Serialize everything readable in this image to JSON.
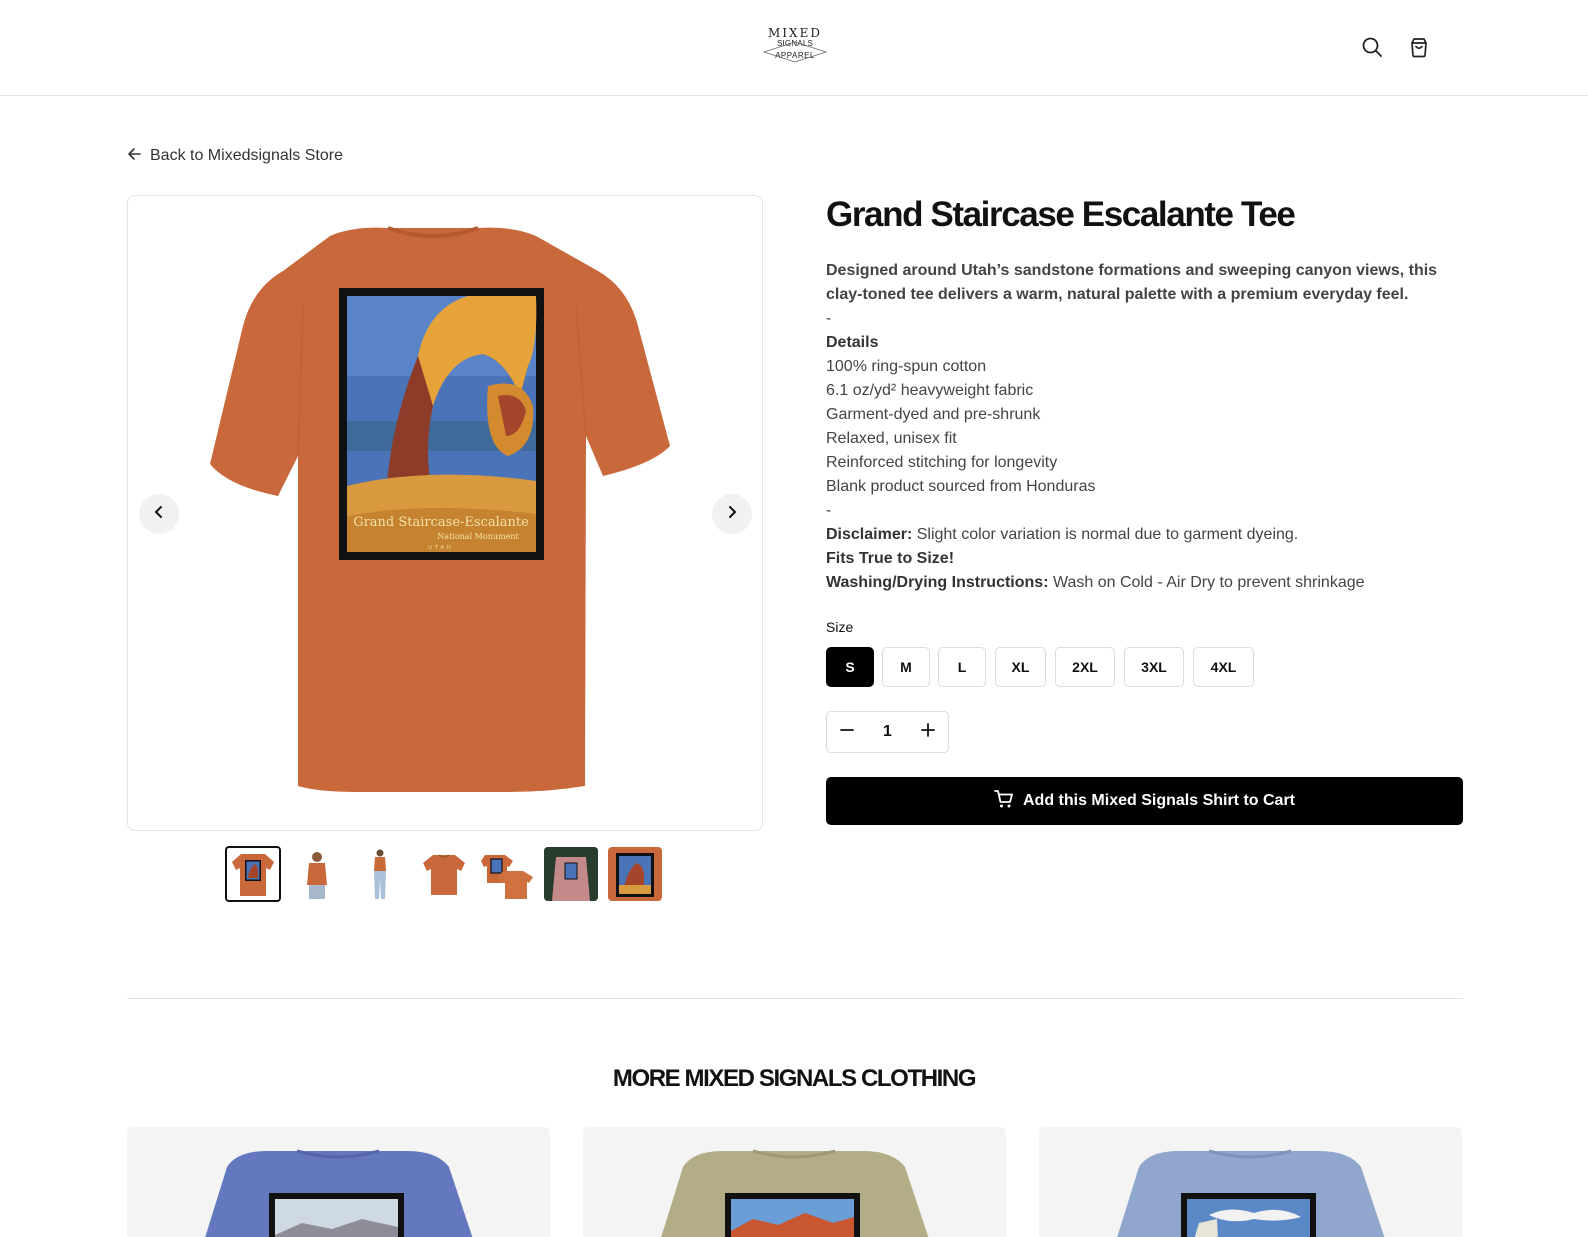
{
  "header": {
    "logo": {
      "line1": "MIXED",
      "line2": "SIGNALS",
      "line3": "APPAREL"
    },
    "search_icon": "search-icon",
    "cart_icon": "shopping-bag-icon"
  },
  "back_link": {
    "label": "Back to Mixedsignals Store",
    "icon": "arrow-left-icon"
  },
  "gallery": {
    "main_image_text": {
      "line1": "Grand Staircase-Escalante",
      "line2": "National Monument",
      "line3": "UTAH"
    },
    "prev_icon": "chevron-left-icon",
    "next_icon": "chevron-right-icon",
    "thumbnail_count": 7,
    "active_thumbnail": 1
  },
  "product": {
    "title": "Grand Staircase Escalante Tee",
    "intro_line1": "Designed around Utah’s sandstone formations and sweeping canyon views, this",
    "intro_line2": "clay-toned tee delivers a warm, natural palette with a premium everyday feel.",
    "separator": "-",
    "details_heading": "Details",
    "details": [
      "100% ring-spun cotton",
      "6.1 oz/yd² heavyweight fabric",
      "Garment-dyed and pre-shrunk",
      "Relaxed, unisex fit",
      "Reinforced stitching for longevity",
      "Blank product sourced from Honduras"
    ],
    "disclaimer_label": "Disclaimer:",
    "disclaimer_text": "Slight color variation is normal due to garment dyeing.",
    "fit_note": "Fits True to Size!",
    "washing_label": "Washing/Drying Instructions:",
    "washing_text": "Wash on Cold - Air Dry to prevent shrinkage",
    "size_label": "Size",
    "sizes": [
      "S",
      "M",
      "L",
      "XL",
      "2XL",
      "3XL",
      "4XL"
    ],
    "selected_size": "S",
    "quantity": "1",
    "add_to_cart_label": "Add this Mixed Signals Shirt to Cart",
    "cart_button_icon": "cart-icon"
  },
  "more": {
    "heading": "MORE MIXED SIGNALS CLOTHING"
  },
  "colors": {
    "shirt_main": "#c9693b",
    "card_shirt_1": "#6478c0",
    "card_shirt_2": "#b2ad86",
    "card_shirt_3": "#8fa7cc",
    "button_black": "#000000"
  }
}
